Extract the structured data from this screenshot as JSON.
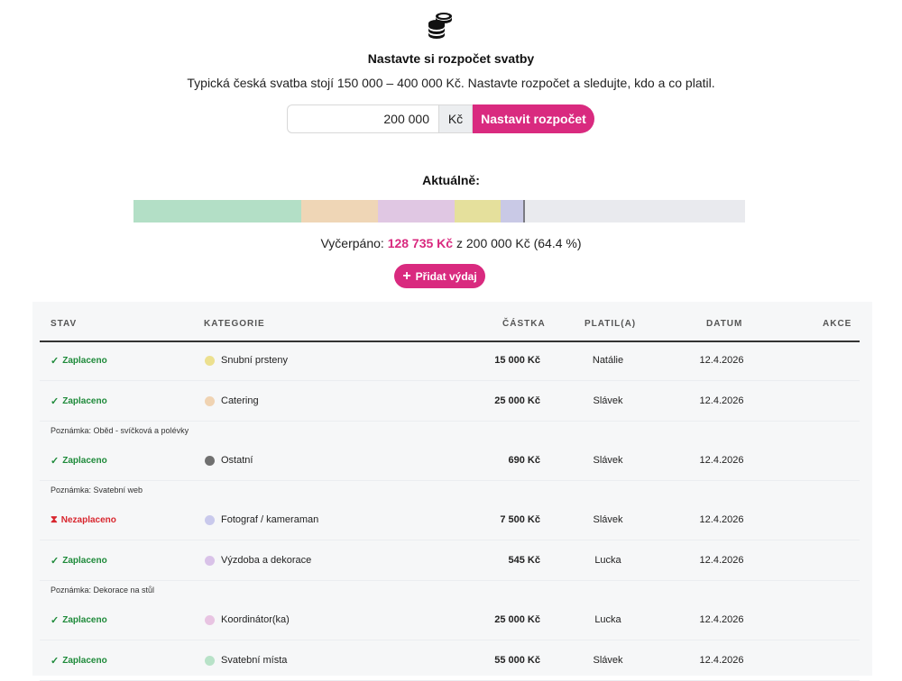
{
  "header": {
    "logo_icon": "stacked-coins-icon",
    "title": "Nastavte si rozpočet svatby",
    "subtitle": "Typická česká svatba stojí 150 000 – 400 000 Kč. Nastavte rozpočet a sledujte, kdo a co platil."
  },
  "budget": {
    "value": "200 000",
    "unit": "Kč",
    "button_label": "Nastavit rozpočet"
  },
  "progress": {
    "heading": "Aktuálně:",
    "spent_label": "Vyčerpáno:",
    "spent_amount": "128 735 Kč",
    "of_text": "z 200 000 Kč (64.4 %)",
    "fraction_spent": 0.644,
    "segments": [
      {
        "category": "Svatební místa",
        "fraction": 0.275,
        "color": "#b3dfc6"
      },
      {
        "category": "Catering",
        "fraction": 0.125,
        "color": "#efd6b6"
      },
      {
        "category": "Výzdoba a dekorace / Koordinátor(ka)",
        "fraction": 0.125,
        "color": "#e0c7e3"
      },
      {
        "category": "Snubní prsteny",
        "fraction": 0.075,
        "color": "#e5e09c"
      },
      {
        "category": "Fotograf / kameraman",
        "fraction": 0.0375,
        "color": "#c9c9e6"
      },
      {
        "category": "Ostatní",
        "fraction": 0.00345,
        "color": "#707070"
      }
    ]
  },
  "add_button": {
    "label": "Přidat výdaj",
    "icon": "plus-icon"
  },
  "table": {
    "headers": {
      "status": "STAV",
      "category": "KATEGORIE",
      "amount": "ČÁSTKA",
      "paid_by": "PLATIL(A)",
      "date": "DATUM",
      "actions": "AKCE"
    },
    "rows": [
      {
        "status": "Zaplaceno",
        "paid": true,
        "category": "Snubní prsteny",
        "color": "#ece08f",
        "amount": "15 000 Kč",
        "paid_by": "Natálie",
        "date": "12.4.2026",
        "note": ""
      },
      {
        "status": "Zaplaceno",
        "paid": true,
        "category": "Catering",
        "color": "#f0d3b2",
        "amount": "25 000 Kč",
        "paid_by": "Slávek",
        "date": "12.4.2026",
        "note": "Poznámka: Oběd - svíčková a polévky"
      },
      {
        "status": "Zaplaceno",
        "paid": true,
        "category": "Ostatní",
        "color": "#707070",
        "amount": "690 Kč",
        "paid_by": "Slávek",
        "date": "12.4.2026",
        "note": "Poznámka: Svatební web"
      },
      {
        "status": "Nezaplaceno",
        "paid": false,
        "category": "Fotograf / kameraman",
        "color": "#c9c9ec",
        "amount": "7 500 Kč",
        "paid_by": "Slávek",
        "date": "12.4.2026",
        "note": ""
      },
      {
        "status": "Zaplaceno",
        "paid": true,
        "category": "Výzdoba a dekorace",
        "color": "#d9c2e8",
        "amount": "545 Kč",
        "paid_by": "Lucka",
        "date": "12.4.2026",
        "note": "Poznámka: Dekorace na stůl"
      },
      {
        "status": "Zaplaceno",
        "paid": true,
        "category": "Koordinátor(ka)",
        "color": "#e8c4e2",
        "amount": "25 000 Kč",
        "paid_by": "Lucka",
        "date": "12.4.2026",
        "note": ""
      },
      {
        "status": "Zaplaceno",
        "paid": true,
        "category": "Svatební místa",
        "color": "#b8e2c8",
        "amount": "55 000 Kč",
        "paid_by": "Slávek",
        "date": "12.4.2026",
        "note": ""
      }
    ]
  }
}
